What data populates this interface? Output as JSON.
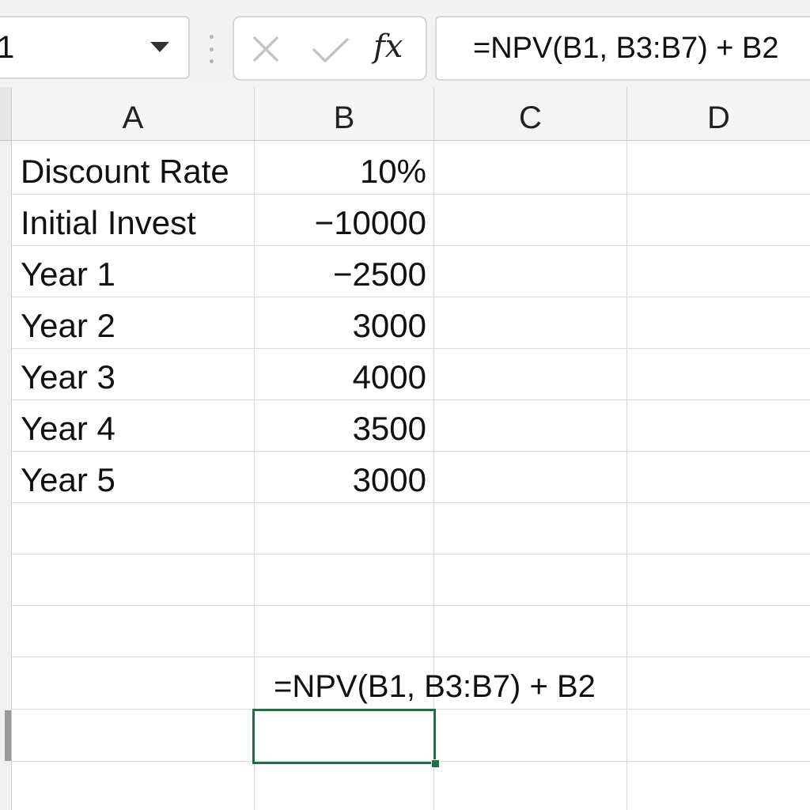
{
  "name_box": {
    "value": "1"
  },
  "formula_bar": {
    "fx_label": "fx",
    "formula": "=NPV(B1, B3:B7) + B2"
  },
  "icons": {
    "name_box_dropdown": "chevron-down-icon",
    "cancel": "close-icon",
    "enter": "check-icon",
    "function": "fx-icon"
  },
  "columns": [
    "A",
    "B",
    "C",
    "D"
  ],
  "rows": [
    {
      "a": "Discount Rate",
      "b": "10%"
    },
    {
      "a": "Initial Invest",
      "b": "−10000"
    },
    {
      "a": "Year 1",
      "b": "−2500"
    },
    {
      "a": "Year 2",
      "b": "3000"
    },
    {
      "a": "Year 3",
      "b": "4000"
    },
    {
      "a": "Year 4",
      "b": "3500"
    },
    {
      "a": "Year 5",
      "b": "3000"
    }
  ],
  "formula_cell": {
    "text": "=NPV(B1, B3:B7) + B2"
  },
  "colors": {
    "selection": "#1e6e48",
    "gridline": "#d9d9d9",
    "header_bg": "#f5f5f5"
  }
}
